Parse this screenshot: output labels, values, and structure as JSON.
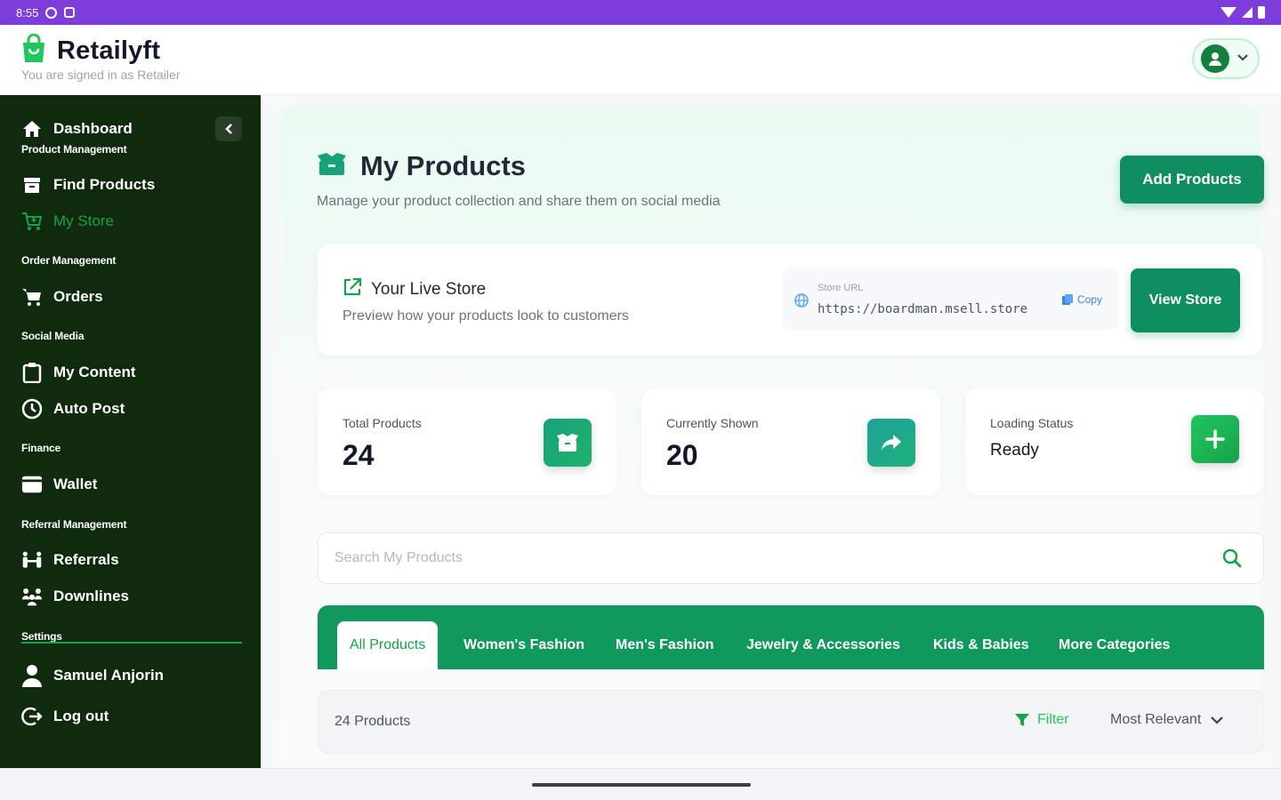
{
  "status_bar": {
    "time": "8:55"
  },
  "app": {
    "name": "Retailyft",
    "signed_in_as": "You are signed in as Retailer"
  },
  "sidebar": {
    "dashboard": "Dashboard",
    "sections": {
      "product": "Product Management",
      "order": "Order Management",
      "social": "Social Media",
      "finance": "Finance",
      "referral": "Referral Management",
      "settings": "Settings"
    },
    "items": {
      "find_products": "Find Products",
      "my_store": "My Store",
      "orders": "Orders",
      "my_content": "My Content",
      "auto_post": "Auto Post",
      "wallet": "Wallet",
      "referrals": "Referrals",
      "downlines": "Downlines",
      "user": "Samuel Anjorin",
      "logout": "Log out"
    }
  },
  "page": {
    "title": "My Products",
    "subtitle": "Manage your product collection and share them on social media",
    "add_button": "Add Products"
  },
  "store": {
    "title": "Your Live Store",
    "subtitle": "Preview how your products look to customers",
    "url_label": "Store URL",
    "url": "https://boardman.msell.store",
    "copy_label": "Copy",
    "view_button": "View Store"
  },
  "stats": [
    {
      "label": "Total Products",
      "value": "24"
    },
    {
      "label": "Currently Shown",
      "value": "20"
    },
    {
      "label": "Loading Status",
      "value": "Ready"
    }
  ],
  "search": {
    "placeholder": "Search My Products"
  },
  "tabs": [
    "All Products",
    "Women's Fashion",
    "Men's Fashion",
    "Jewelry & Accessories",
    "Kids & Babies",
    "More Categories"
  ],
  "list": {
    "count": "24 Products",
    "filter_label": "Filter",
    "sort_label": "Most Relevant"
  },
  "colors": {
    "brand_green": "#10985d",
    "sidebar_bg": "#0f2a0d",
    "status_bar": "#7e3ddb"
  }
}
